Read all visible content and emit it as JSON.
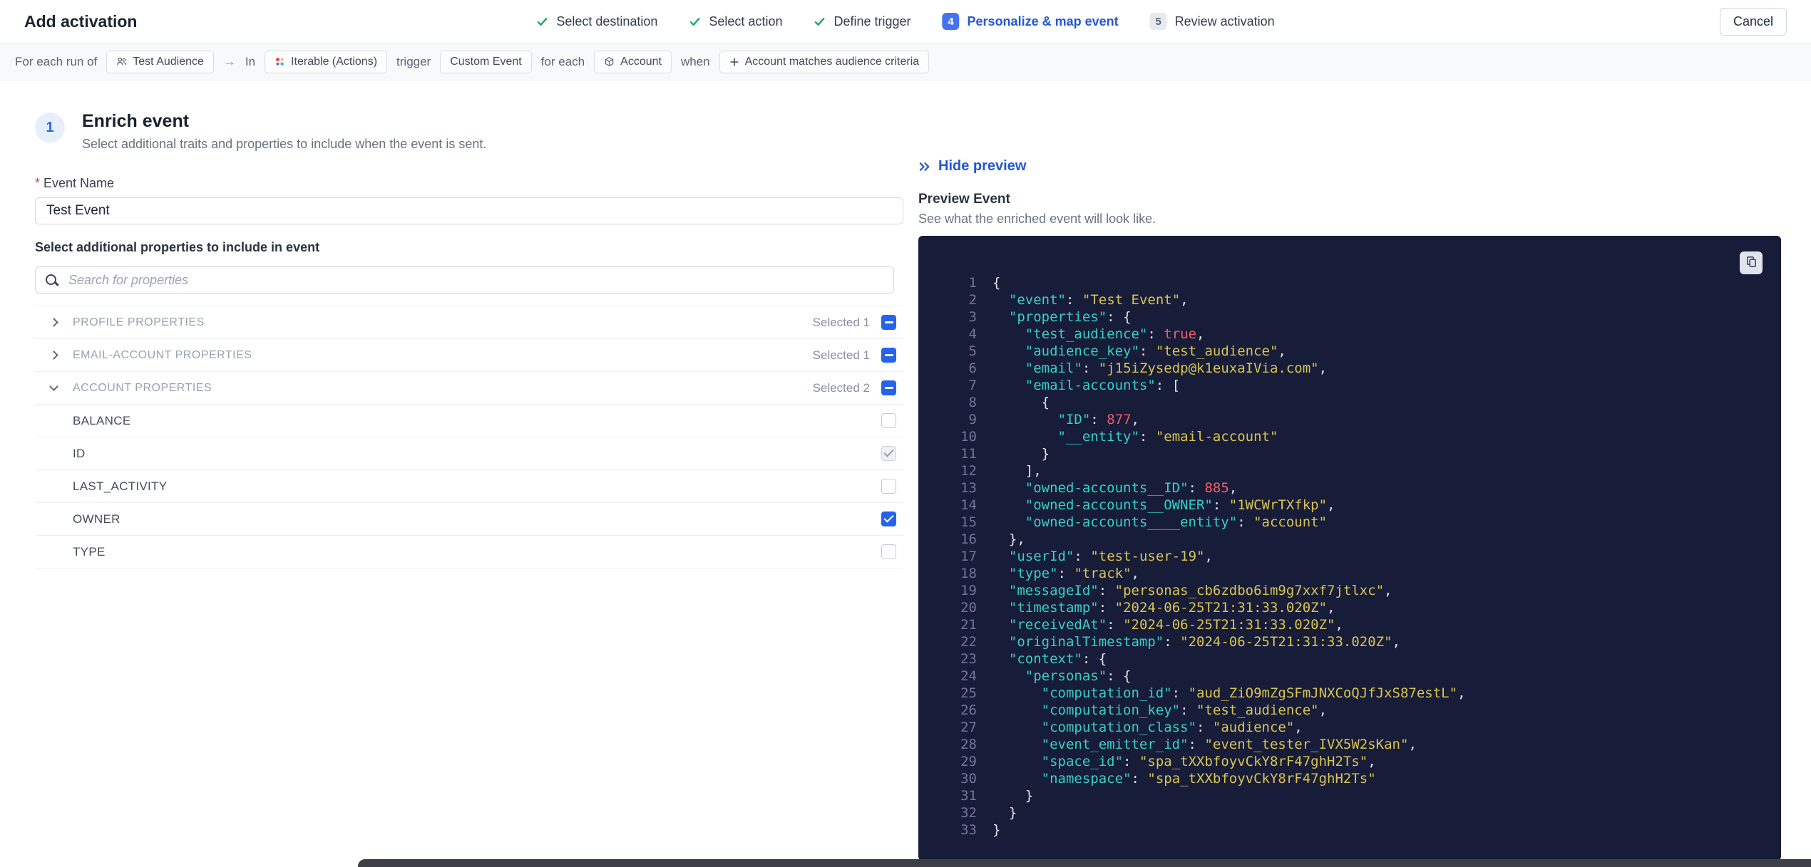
{
  "header": {
    "title": "Add activation",
    "cancel_label": "Cancel",
    "steps": [
      {
        "label": "Select destination",
        "state": "done"
      },
      {
        "label": "Select action",
        "state": "done"
      },
      {
        "label": "Define trigger",
        "state": "done"
      },
      {
        "label": "Personalize & map event",
        "state": "active",
        "number": "4"
      },
      {
        "label": "Review activation",
        "state": "upcoming",
        "number": "5"
      }
    ]
  },
  "context_bar": {
    "tokens": [
      {
        "type": "text",
        "name": "context-text-for-each-run",
        "label": "For each run of"
      },
      {
        "type": "chip",
        "name": "audience-chip",
        "icon": "audience-icon",
        "label": "Test Audience"
      },
      {
        "type": "text",
        "name": "arrow",
        "label": "→"
      },
      {
        "type": "text",
        "name": "context-text-in",
        "label": "In"
      },
      {
        "type": "chip",
        "name": "destination-chip",
        "icon": "iterable-icon",
        "label": "Iterable (Actions)"
      },
      {
        "type": "text",
        "name": "context-text-trigger",
        "label": "trigger"
      },
      {
        "type": "chip",
        "name": "trigger-chip",
        "label": "Custom Event"
      },
      {
        "type": "text",
        "name": "context-text-for-each",
        "label": "for each"
      },
      {
        "type": "chip",
        "name": "entity-chip",
        "icon": "account-icon",
        "label": "Account"
      },
      {
        "type": "text",
        "name": "context-text-when",
        "label": "when"
      },
      {
        "type": "chip",
        "name": "criteria-chip",
        "icon": "plus-icon",
        "label": "Account matches audience criteria"
      }
    ]
  },
  "enrich": {
    "step_number": "1",
    "title": "Enrich event",
    "subtitle": "Select additional traits and properties to include when the event is sent.",
    "required_marker": "*",
    "event_name_label": "Event Name",
    "event_name_value": "Test Event",
    "properties_label": "Select additional properties to include in event",
    "search_placeholder": "Search for properties",
    "groups": [
      {
        "label": "PROFILE PROPERTIES",
        "selected_label": "Selected 1",
        "expanded": false,
        "items": []
      },
      {
        "label": "EMAIL-ACCOUNT PROPERTIES",
        "selected_label": "Selected 1",
        "expanded": false,
        "items": []
      },
      {
        "label": "ACCOUNT PROPERTIES",
        "selected_label": "Selected 2",
        "expanded": true,
        "items": [
          {
            "label": "BALANCE",
            "state": "unchecked"
          },
          {
            "label": "ID",
            "state": "checked-muted"
          },
          {
            "label": "LAST_ACTIVITY",
            "state": "unchecked"
          },
          {
            "label": "OWNER",
            "state": "checked"
          },
          {
            "label": "TYPE",
            "state": "unchecked"
          }
        ]
      }
    ]
  },
  "preview": {
    "hide_label": "Hide preview",
    "title": "Preview Event",
    "subtitle": "See what the enriched event will look like.",
    "code_lines": [
      "{",
      "  \"event\": \"Test Event\",",
      "  \"properties\": {",
      "    \"test_audience\": true,",
      "    \"audience_key\": \"test_audience\",",
      "    \"email\": \"j15iZysedp@k1euxaIVia.com\",",
      "    \"email-accounts\": [",
      "      {",
      "        \"ID\": 877,",
      "        \"__entity\": \"email-account\"",
      "      }",
      "    ],",
      "    \"owned-accounts__ID\": 885,",
      "    \"owned-accounts__OWNER\": \"1WCWrTXfkp\",",
      "    \"owned-accounts____entity\": \"account\"",
      "  },",
      "  \"userId\": \"test-user-19\",",
      "  \"type\": \"track\",",
      "  \"messageId\": \"personas_cb6zdbo6im9g7xxf7jtlxc\",",
      "  \"timestamp\": \"2024-06-25T21:31:33.020Z\",",
      "  \"receivedAt\": \"2024-06-25T21:31:33.020Z\",",
      "  \"originalTimestamp\": \"2024-06-25T21:31:33.020Z\",",
      "  \"context\": {",
      "    \"personas\": {",
      "      \"computation_id\": \"aud_ZiO9mZgSFmJNXCoQJfJxS87estL\",",
      "      \"computation_key\": \"test_audience\",",
      "      \"computation_class\": \"audience\",",
      "      \"event_emitter_id\": \"event_tester_IVX5W2sKan\",",
      "      \"space_id\": \"spa_tXXbfoyvCkY8rF47ghH2Ts\",",
      "      \"namespace\": \"spa_tXXbfoyvCkY8rF47ghH2Ts\"",
      "    }",
      "  }",
      "}"
    ]
  },
  "colors": {
    "accent_blue": "#2457d6",
    "checkbox_blue": "#2563eb",
    "step_done_green": "#27a860",
    "code_background": "#171c38",
    "code_key": "#37d0c6",
    "code_string": "#d8c454",
    "code_number": "#ef5e6e"
  }
}
